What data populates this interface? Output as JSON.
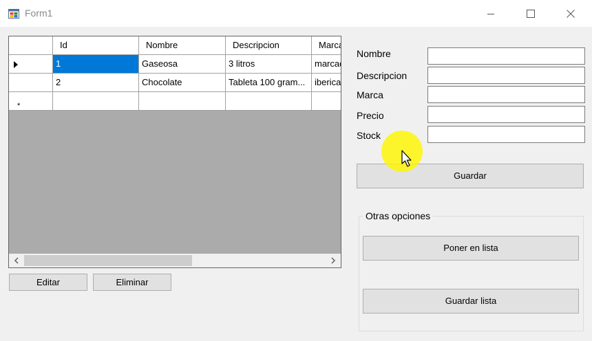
{
  "window": {
    "title": "Form1"
  },
  "grid": {
    "columns": [
      "Id",
      "Nombre",
      "Descripcion",
      "Marca"
    ],
    "rows": [
      {
        "id": "1",
        "nombre": "Gaseosa",
        "descripcion": "3 litros",
        "marca": "marcad"
      },
      {
        "id": "2",
        "nombre": "Chocolate",
        "descripcion": "Tableta 100 gram...",
        "marca": "iberica"
      }
    ],
    "new_row_marker": "*"
  },
  "buttons": {
    "edit": "Editar",
    "delete": "Eliminar",
    "save": "Guardar"
  },
  "form": {
    "nombre_label": "Nombre",
    "descripcion_label": "Descripcion",
    "marca_label": "Marca",
    "precio_label": "Precio",
    "stock_label": "Stock"
  },
  "options": {
    "title": "Otras opciones",
    "add_to_list": "Poner en lista",
    "save_list": "Guardar lista"
  },
  "colors": {
    "selection": "#0078d7",
    "grid_background": "#ababab",
    "cursor_highlight": "#fff500"
  }
}
